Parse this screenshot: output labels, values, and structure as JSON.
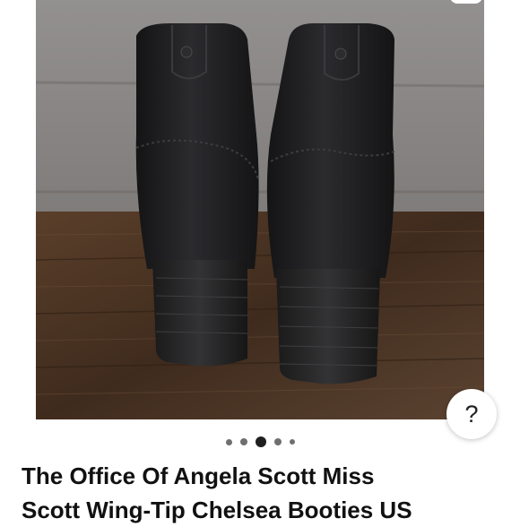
{
  "product": {
    "image_alt": "black leather ankle boots, rear view",
    "title_lines": [
      "The Office Of Angela Scott Miss",
      "Scott Wing-Tip Chelsea Booties US"
    ]
  },
  "gallery": {
    "dot_count": 5,
    "active_index": 2
  },
  "help_button": {
    "label": "?"
  },
  "colors": {
    "wall": "#8f8c89",
    "floor": "#4b3423",
    "boot": "#1c1c1e",
    "text": "#111111"
  }
}
